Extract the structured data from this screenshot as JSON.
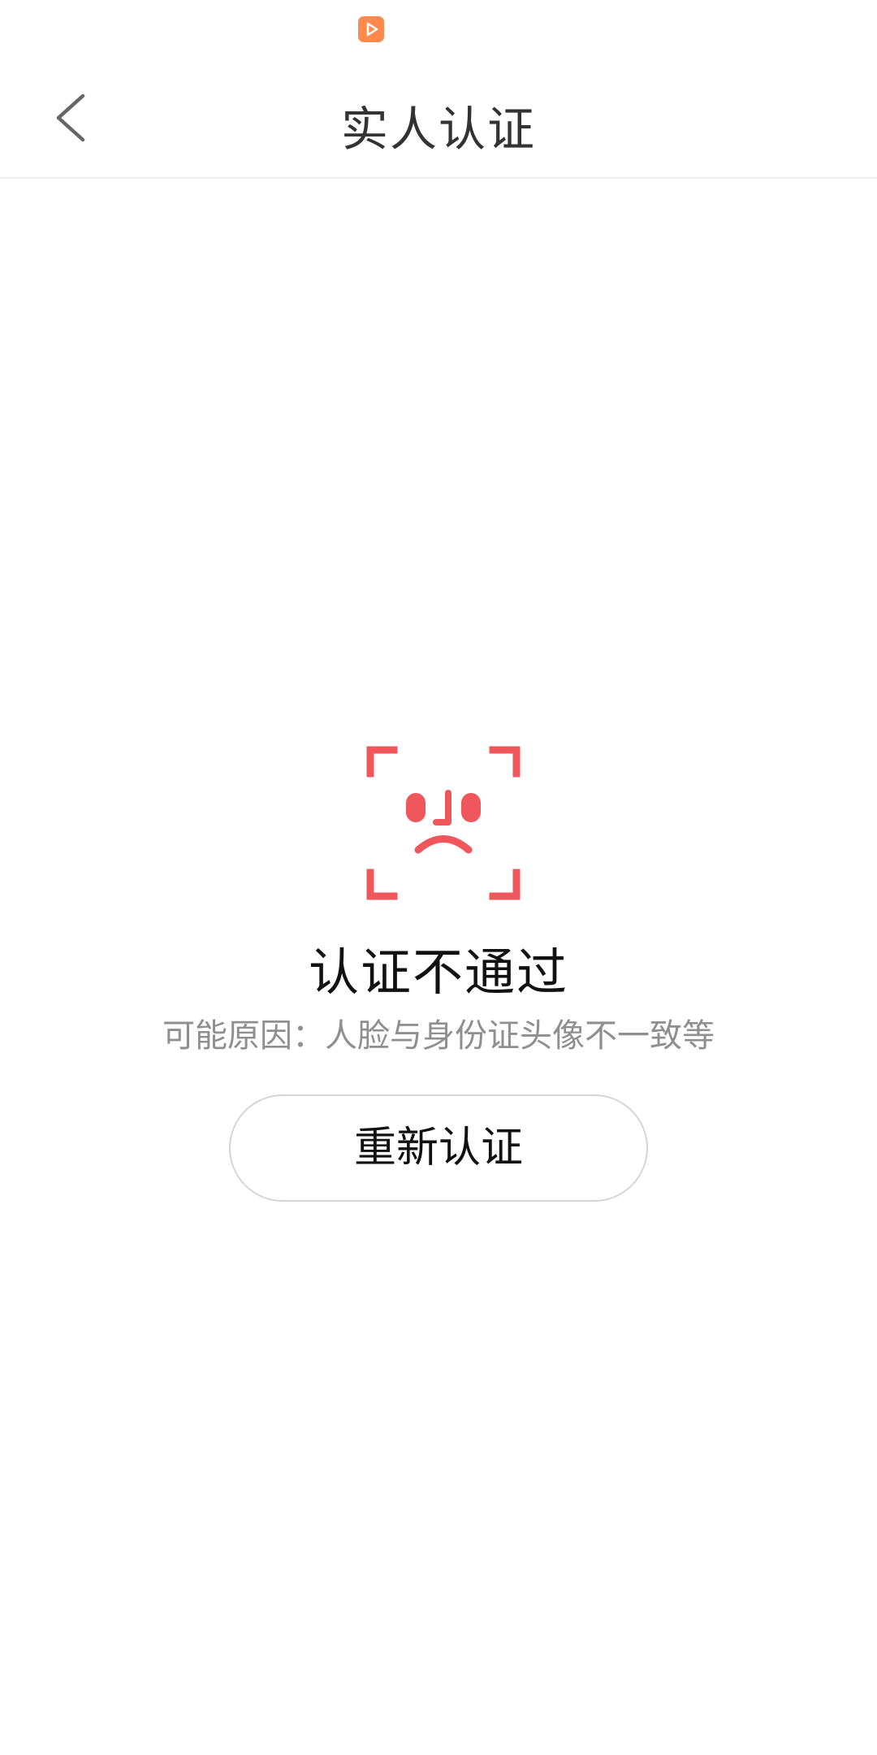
{
  "status_bar": {
    "app_icon": "video-play-icon",
    "app_icon_color": "#ff8a4c"
  },
  "header": {
    "back_icon": "chevron-left-icon",
    "title": "实人认证"
  },
  "result": {
    "icon": "face-sad-icon",
    "icon_color": "#f0575d",
    "title": "认证不通过",
    "reason": "可能原因：人脸与身份证头像不一致等"
  },
  "actions": {
    "retry_label": "重新认证"
  },
  "colors": {
    "accent_red": "#f0575d",
    "title_text": "#333333",
    "secondary_text": "#8f8f8f",
    "divider": "#eeeeee"
  }
}
